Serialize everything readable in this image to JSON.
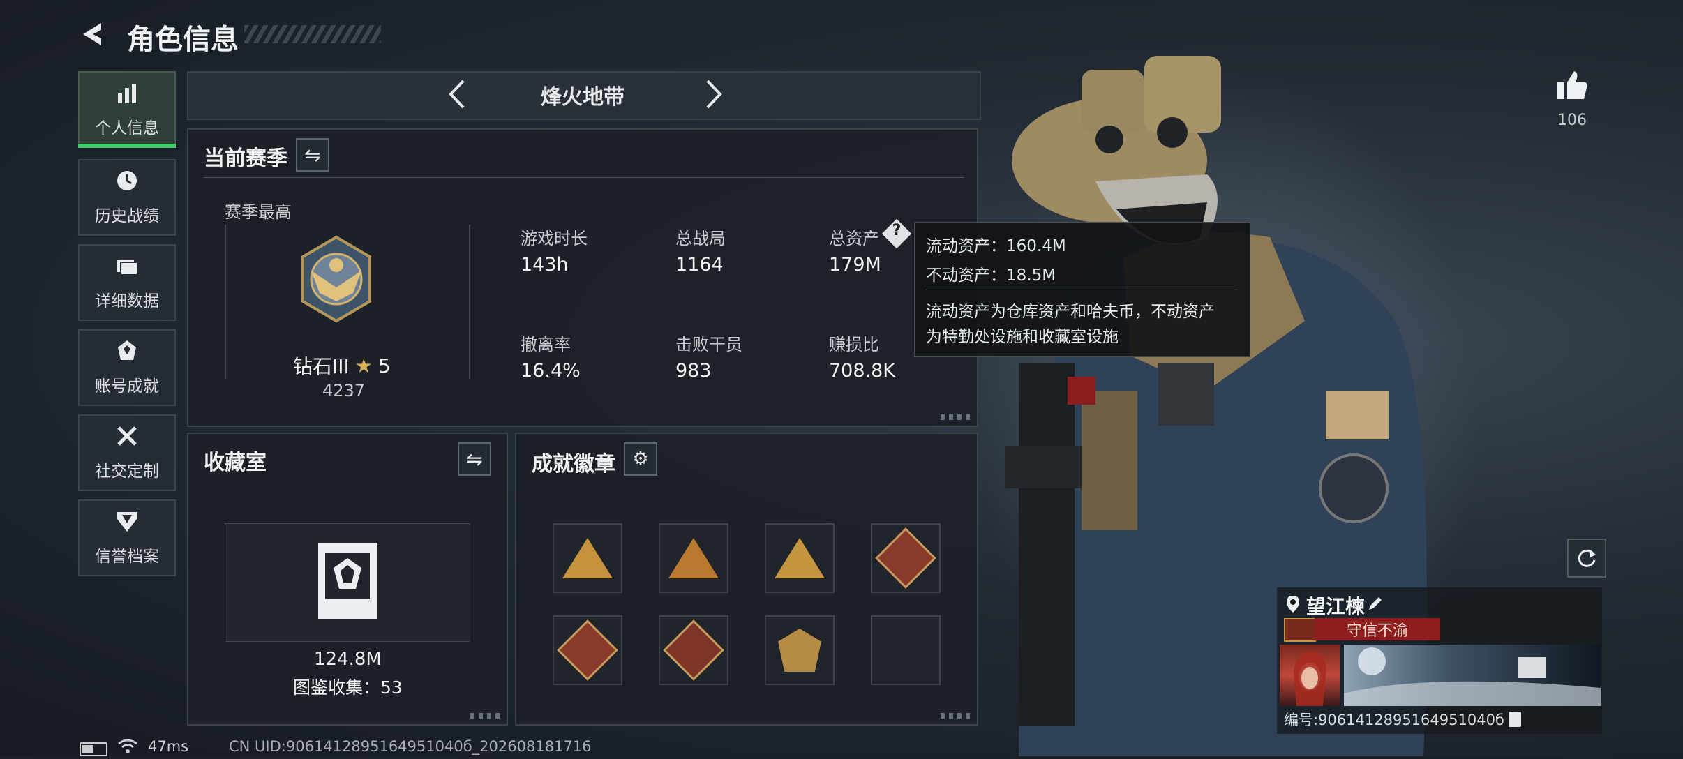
{
  "header": {
    "title": "角色信息"
  },
  "sidebar": {
    "items": [
      {
        "label": "个人信息",
        "icon": "bar-chart-icon",
        "active": true
      },
      {
        "label": "历史战绩",
        "icon": "history-clock-icon"
      },
      {
        "label": "详细数据",
        "icon": "folder-icon"
      },
      {
        "label": "账号成就",
        "icon": "achievement-icon"
      },
      {
        "label": "社交定制",
        "icon": "tools-icon"
      },
      {
        "label": "信誉档案",
        "icon": "reputation-icon"
      }
    ]
  },
  "mode_selector": {
    "label": "烽火地带"
  },
  "season": {
    "title": "当前赛季",
    "best_label": "赛季最高",
    "rank": "钻石III",
    "stars": "5",
    "score": "4237",
    "stats": [
      {
        "label": "游戏时长",
        "value": "143h"
      },
      {
        "label": "总战局",
        "value": "1164"
      },
      {
        "label": "总资产",
        "value": "179M"
      },
      {
        "label": "撤离率",
        "value": "16.4%"
      },
      {
        "label": "击败干员",
        "value": "983"
      },
      {
        "label": "赚损比",
        "value": "708.8K"
      }
    ]
  },
  "tooltip": {
    "liquid": "流动资产：160.4M",
    "fixed": "不动资产：18.5M",
    "desc_line1": "流动资产为仓库资产和哈夫币，不动资产",
    "desc_line2": "为特勤处设施和收藏室设施"
  },
  "collection": {
    "title": "收藏室",
    "value": "124.8M",
    "count_text": "图鉴收集：53"
  },
  "achievements": {
    "title": "成就徽章",
    "badges": [
      "ship",
      "number-one",
      "vault",
      "dragon",
      "dragon",
      "runner",
      "soldier",
      "empty"
    ]
  },
  "likes": {
    "count": "106"
  },
  "profile": {
    "name": "望江楝",
    "title_badge": "守信不渝",
    "id_text": "编号:9061412895164951040б"
  },
  "status_bar": {
    "ping": "47ms",
    "uid": "CN UID:9061412895164951040б_202608181716"
  },
  "colors": {
    "accent_green": "#3ecf6a",
    "title_badge_red": "#8e1e1e"
  }
}
